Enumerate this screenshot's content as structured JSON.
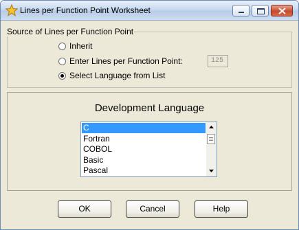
{
  "window": {
    "title": "Lines per Function Point Worksheet"
  },
  "source_group": {
    "legend": "Source of Lines per Function Point",
    "options": [
      {
        "label": "Inherit",
        "checked": false
      },
      {
        "label": "Enter Lines per Function Point:",
        "checked": false
      },
      {
        "label": "Select Language from List",
        "checked": true
      }
    ],
    "lines_per_fp_value": "125"
  },
  "language": {
    "label": "Development Language",
    "items": [
      "C",
      "Fortran",
      "COBOL",
      "Basic",
      "Pascal"
    ],
    "selected": "C"
  },
  "buttons": {
    "ok": "OK",
    "cancel": "Cancel",
    "help": "Help"
  }
}
